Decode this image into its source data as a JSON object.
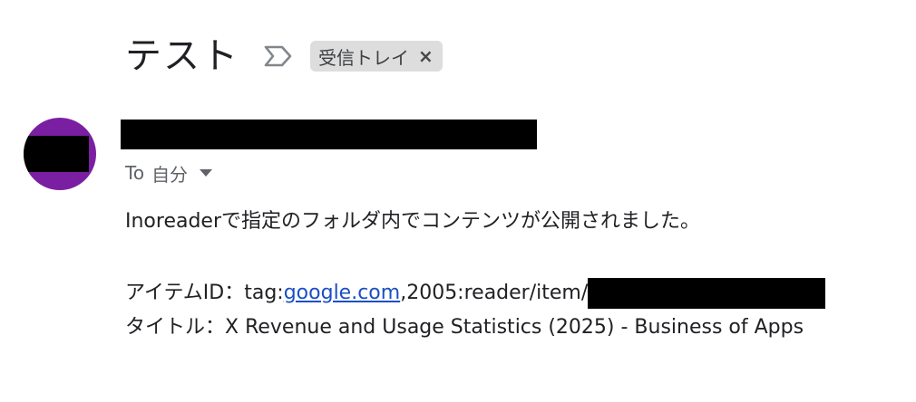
{
  "message": {
    "subject": "テスト",
    "label_chip": {
      "text": "受信トレイ",
      "remove_glyph": "×"
    },
    "recipient": {
      "prefix": "To",
      "name": "自分"
    },
    "body": {
      "intro": "Inoreaderで指定のフォルダ内でコンテンツが公開されました。",
      "item_id": {
        "label": "アイテムID：tag:",
        "link_text": "google.com",
        "suffix": ",2005:reader/item/"
      },
      "title_line": "タイトル：X Revenue and Usage Statistics (2025) - Business of Apps"
    }
  },
  "icons": {
    "importance_marker": "label-importance-outline-icon",
    "details_toggle": "caret-down-icon"
  },
  "colors": {
    "avatar": "#7b1fa2",
    "link": "#1a4fc4",
    "chip_background": "#dddddd",
    "redaction": "#000000"
  }
}
